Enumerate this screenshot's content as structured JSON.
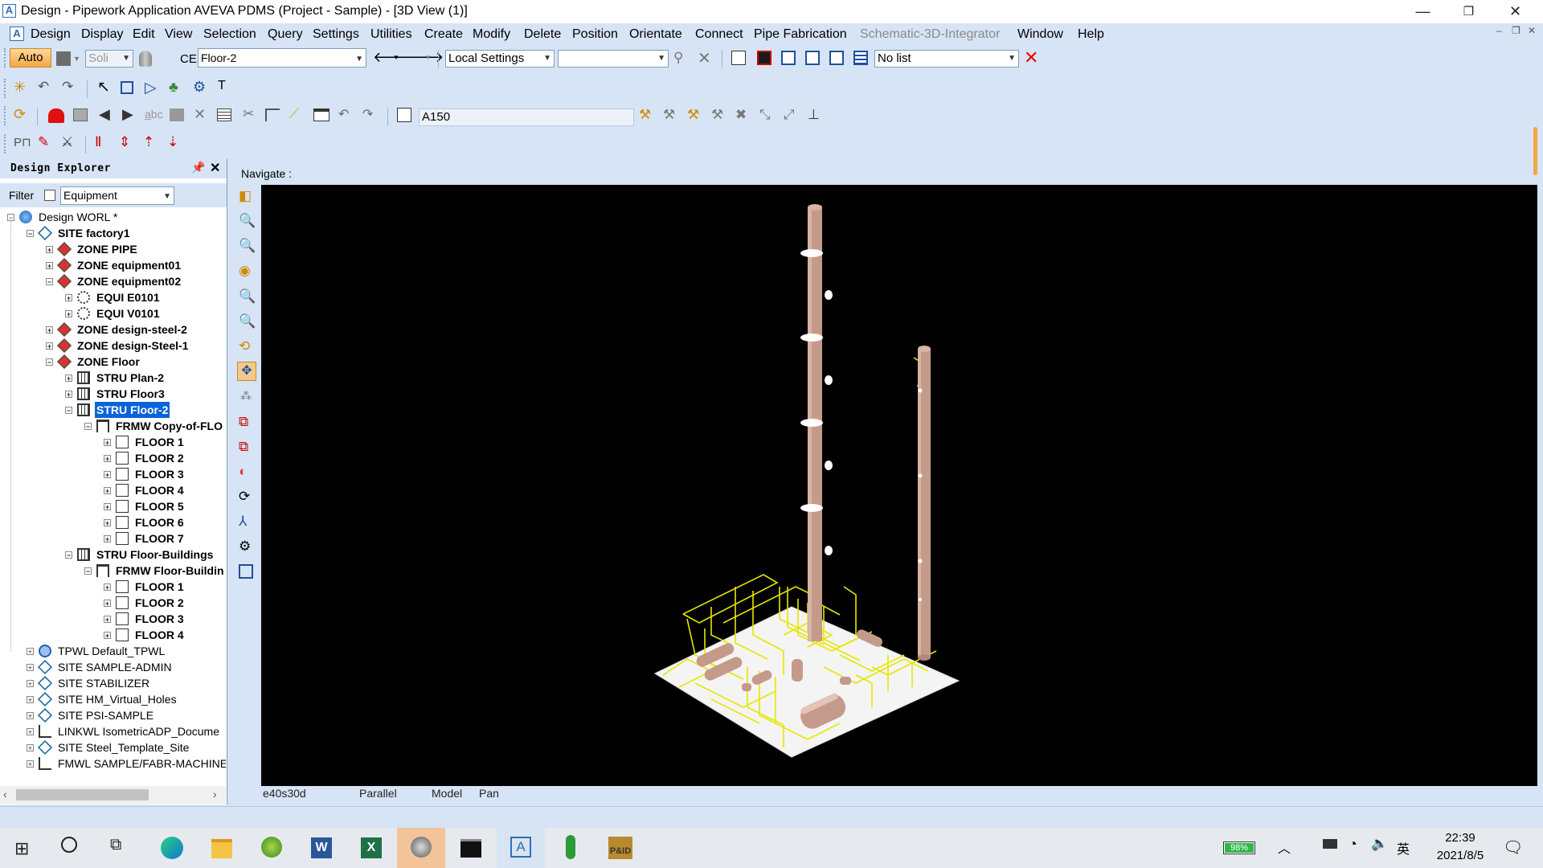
{
  "window": {
    "title": "Design - Pipework Application  AVEVA PDMS (Project - Sample) - [3D View (1)]",
    "app_icon": "A",
    "controls": {
      "minimize": "—",
      "restore": "❐",
      "close": "✕"
    }
  },
  "menu": [
    "Design",
    "Display",
    "Edit",
    "View",
    "Selection",
    "Query",
    "Settings",
    "Utilities",
    "Create",
    "Modify",
    "Delete",
    "Position",
    "Orientate",
    "Connect",
    "Pipe Fabrication",
    "Schematic-3D-Integrator",
    "Window",
    "Help"
  ],
  "toolbar1": {
    "auto_label": "Auto",
    "solid_combo": "Soli",
    "ce_label": "CE",
    "ce_value": "Floor-2",
    "local_settings": "Local Settings",
    "blank_combo": "",
    "list_combo": "No list"
  },
  "toolbar3": {
    "element_field": "A150"
  },
  "explorer": {
    "title": "Design Explorer",
    "filter_label": "Filter",
    "filter_value": "Equipment",
    "tree": [
      {
        "label": "Design WORL *",
        "icon": "globe-icon",
        "bold": false
      },
      {
        "label": "SITE factory1",
        "icon": "site-icon",
        "bold": true
      },
      {
        "label": "ZONE PIPE",
        "icon": "zone-icon",
        "bold": true
      },
      {
        "label": "ZONE equipment01",
        "icon": "zone-icon",
        "bold": true
      },
      {
        "label": "ZONE equipment02",
        "icon": "zone-icon",
        "bold": true
      },
      {
        "label": "EQUI E0101",
        "icon": "equipment-icon",
        "bold": true
      },
      {
        "label": "EQUI V0101",
        "icon": "equipment-icon",
        "bold": true
      },
      {
        "label": "ZONE design-steel-2",
        "icon": "zone-icon",
        "bold": true
      },
      {
        "label": "ZONE design-Steel-1",
        "icon": "zone-icon",
        "bold": true
      },
      {
        "label": "ZONE Floor",
        "icon": "zone-icon",
        "bold": true
      },
      {
        "label": "STRU Plan-2",
        "icon": "structure-icon",
        "bold": true
      },
      {
        "label": "STRU Floor3",
        "icon": "structure-icon",
        "bold": true
      },
      {
        "label": "STRU Floor-2",
        "icon": "structure-icon",
        "bold": true,
        "selected": true
      },
      {
        "label": "FRMW Copy-of-FLO",
        "icon": "framework-icon",
        "bold": true
      },
      {
        "label": "FLOOR 1",
        "icon": "floor-icon",
        "bold": true
      },
      {
        "label": "FLOOR 2",
        "icon": "floor-icon",
        "bold": true
      },
      {
        "label": "FLOOR 3",
        "icon": "floor-icon",
        "bold": true
      },
      {
        "label": "FLOOR 4",
        "icon": "floor-icon",
        "bold": true
      },
      {
        "label": "FLOOR 5",
        "icon": "floor-icon",
        "bold": true
      },
      {
        "label": "FLOOR 6",
        "icon": "floor-icon",
        "bold": true
      },
      {
        "label": "FLOOR 7",
        "icon": "floor-icon",
        "bold": true
      },
      {
        "label": "STRU Floor-Buildings",
        "icon": "structure-icon",
        "bold": true
      },
      {
        "label": "FRMW Floor-Buildin",
        "icon": "framework-icon",
        "bold": true
      },
      {
        "label": "FLOOR 1",
        "icon": "floor-icon",
        "bold": true
      },
      {
        "label": "FLOOR 2",
        "icon": "floor-icon",
        "bold": true
      },
      {
        "label": "FLOOR 3",
        "icon": "floor-icon",
        "bold": true
      },
      {
        "label": "FLOOR 4",
        "icon": "floor-icon",
        "bold": true
      },
      {
        "label": "TPWL Default_TPWL",
        "icon": "world-icon",
        "bold": false
      },
      {
        "label": "SITE SAMPLE-ADMIN",
        "icon": "site-icon",
        "bold": false
      },
      {
        "label": "SITE STABILIZER",
        "icon": "site-icon",
        "bold": false
      },
      {
        "label": "SITE HM_Virtual_Holes",
        "icon": "site-icon",
        "bold": false
      },
      {
        "label": "SITE PSI-SAMPLE",
        "icon": "site-icon",
        "bold": false
      },
      {
        "label": "LINKWL IsometricADP_Docume",
        "icon": "link-icon",
        "bold": false
      },
      {
        "label": "SITE Steel_Template_Site",
        "icon": "site-icon",
        "bold": false
      },
      {
        "label": "FMWL SAMPLE/FABR-MACHINE",
        "icon": "link-icon",
        "bold": false
      }
    ]
  },
  "view": {
    "navigate_label": "Navigate :",
    "status": {
      "view_direction": "e40s30d",
      "projection": "Parallel",
      "mode": "Model",
      "action": "Pan"
    }
  },
  "taskbar": {
    "battery": "98%",
    "ime": "英",
    "time": "22:39",
    "date": "2021/8/5"
  },
  "colors": {
    "chrome": "#d6e4f5",
    "selection": "#0a64d8",
    "canvas": "#000000",
    "pipe": "#e6e600",
    "vessel": "#c49a8a"
  }
}
